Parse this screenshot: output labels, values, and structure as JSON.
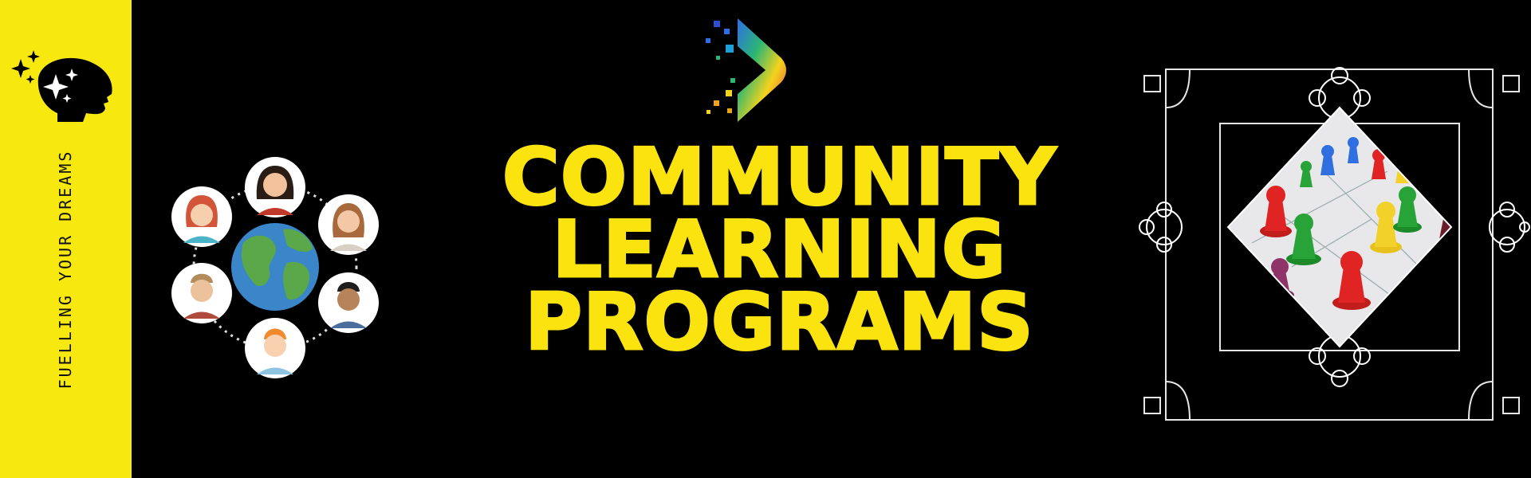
{
  "banner": {
    "tagline": "FUELLING YOUR DREAMS",
    "title_lines": [
      "COMMUNITY",
      "LEARNING",
      "PROGRAMS"
    ]
  },
  "colors": {
    "background": "#000000",
    "accent_yellow": "#f7e80f",
    "title_yellow": "#fbe30f"
  },
  "icons": [
    "head-sparkles-icon",
    "brand-logo-icon",
    "globe-icon",
    "person-avatar-icon",
    "game-pieces-photo"
  ]
}
